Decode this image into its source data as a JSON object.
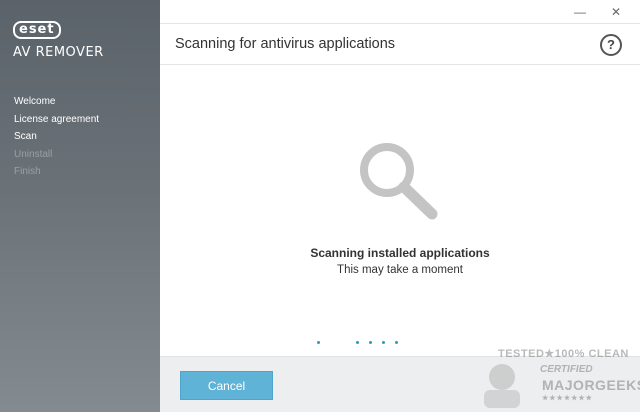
{
  "sidebar": {
    "logo_brand": "eset",
    "logo_product": "AV REMOVER",
    "steps": [
      {
        "label": "Welcome",
        "state": "done"
      },
      {
        "label": "License agreement",
        "state": "done"
      },
      {
        "label": "Scan",
        "state": "current"
      },
      {
        "label": "Uninstall",
        "state": "pending"
      },
      {
        "label": "Finish",
        "state": "pending"
      }
    ]
  },
  "window": {
    "minimize_glyph": "—",
    "close_glyph": "✕"
  },
  "header": {
    "title": "Scanning for antivirus applications",
    "help_glyph": "?"
  },
  "main": {
    "icon": "magnifier-icon",
    "status_title": "Scanning installed applications",
    "status_subtitle": "This may take a moment"
  },
  "footer": {
    "cancel_label": "Cancel"
  },
  "watermark": {
    "top": "TESTED★100% CLEAN",
    "middle": "CERTIFIED",
    "bottom": "MAJORGEEKS",
    "stars": "★★★★★★★"
  },
  "colors": {
    "accent": "#5fb3d7",
    "progress_dot": "#2b9bc0",
    "sidebar_top": "#5b636a",
    "sidebar_bottom": "#848b90",
    "step_pending": "#9aa0a4"
  }
}
